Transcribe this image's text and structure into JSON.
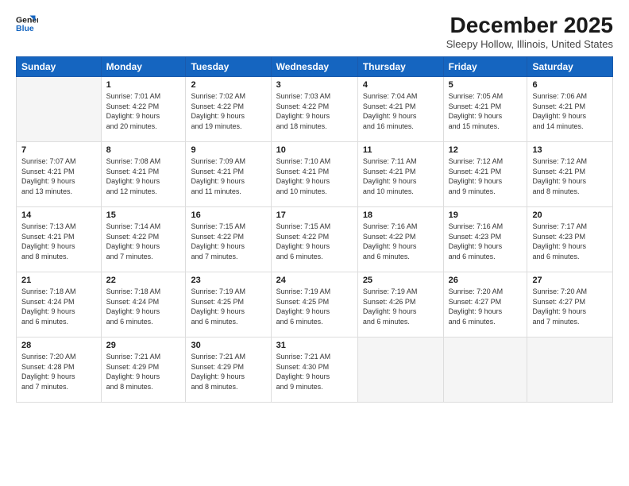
{
  "logo": {
    "line1": "General",
    "line2": "Blue"
  },
  "header": {
    "title": "December 2025",
    "location": "Sleepy Hollow, Illinois, United States"
  },
  "days_of_week": [
    "Sunday",
    "Monday",
    "Tuesday",
    "Wednesday",
    "Thursday",
    "Friday",
    "Saturday"
  ],
  "weeks": [
    [
      {
        "num": "",
        "info": ""
      },
      {
        "num": "1",
        "info": "Sunrise: 7:01 AM\nSunset: 4:22 PM\nDaylight: 9 hours\nand 20 minutes."
      },
      {
        "num": "2",
        "info": "Sunrise: 7:02 AM\nSunset: 4:22 PM\nDaylight: 9 hours\nand 19 minutes."
      },
      {
        "num": "3",
        "info": "Sunrise: 7:03 AM\nSunset: 4:22 PM\nDaylight: 9 hours\nand 18 minutes."
      },
      {
        "num": "4",
        "info": "Sunrise: 7:04 AM\nSunset: 4:21 PM\nDaylight: 9 hours\nand 16 minutes."
      },
      {
        "num": "5",
        "info": "Sunrise: 7:05 AM\nSunset: 4:21 PM\nDaylight: 9 hours\nand 15 minutes."
      },
      {
        "num": "6",
        "info": "Sunrise: 7:06 AM\nSunset: 4:21 PM\nDaylight: 9 hours\nand 14 minutes."
      }
    ],
    [
      {
        "num": "7",
        "info": "Sunrise: 7:07 AM\nSunset: 4:21 PM\nDaylight: 9 hours\nand 13 minutes."
      },
      {
        "num": "8",
        "info": "Sunrise: 7:08 AM\nSunset: 4:21 PM\nDaylight: 9 hours\nand 12 minutes."
      },
      {
        "num": "9",
        "info": "Sunrise: 7:09 AM\nSunset: 4:21 PM\nDaylight: 9 hours\nand 11 minutes."
      },
      {
        "num": "10",
        "info": "Sunrise: 7:10 AM\nSunset: 4:21 PM\nDaylight: 9 hours\nand 10 minutes."
      },
      {
        "num": "11",
        "info": "Sunrise: 7:11 AM\nSunset: 4:21 PM\nDaylight: 9 hours\nand 10 minutes."
      },
      {
        "num": "12",
        "info": "Sunrise: 7:12 AM\nSunset: 4:21 PM\nDaylight: 9 hours\nand 9 minutes."
      },
      {
        "num": "13",
        "info": "Sunrise: 7:12 AM\nSunset: 4:21 PM\nDaylight: 9 hours\nand 8 minutes."
      }
    ],
    [
      {
        "num": "14",
        "info": "Sunrise: 7:13 AM\nSunset: 4:21 PM\nDaylight: 9 hours\nand 8 minutes."
      },
      {
        "num": "15",
        "info": "Sunrise: 7:14 AM\nSunset: 4:22 PM\nDaylight: 9 hours\nand 7 minutes."
      },
      {
        "num": "16",
        "info": "Sunrise: 7:15 AM\nSunset: 4:22 PM\nDaylight: 9 hours\nand 7 minutes."
      },
      {
        "num": "17",
        "info": "Sunrise: 7:15 AM\nSunset: 4:22 PM\nDaylight: 9 hours\nand 6 minutes."
      },
      {
        "num": "18",
        "info": "Sunrise: 7:16 AM\nSunset: 4:22 PM\nDaylight: 9 hours\nand 6 minutes."
      },
      {
        "num": "19",
        "info": "Sunrise: 7:16 AM\nSunset: 4:23 PM\nDaylight: 9 hours\nand 6 minutes."
      },
      {
        "num": "20",
        "info": "Sunrise: 7:17 AM\nSunset: 4:23 PM\nDaylight: 9 hours\nand 6 minutes."
      }
    ],
    [
      {
        "num": "21",
        "info": "Sunrise: 7:18 AM\nSunset: 4:24 PM\nDaylight: 9 hours\nand 6 minutes."
      },
      {
        "num": "22",
        "info": "Sunrise: 7:18 AM\nSunset: 4:24 PM\nDaylight: 9 hours\nand 6 minutes."
      },
      {
        "num": "23",
        "info": "Sunrise: 7:19 AM\nSunset: 4:25 PM\nDaylight: 9 hours\nand 6 minutes."
      },
      {
        "num": "24",
        "info": "Sunrise: 7:19 AM\nSunset: 4:25 PM\nDaylight: 9 hours\nand 6 minutes."
      },
      {
        "num": "25",
        "info": "Sunrise: 7:19 AM\nSunset: 4:26 PM\nDaylight: 9 hours\nand 6 minutes."
      },
      {
        "num": "26",
        "info": "Sunrise: 7:20 AM\nSunset: 4:27 PM\nDaylight: 9 hours\nand 6 minutes."
      },
      {
        "num": "27",
        "info": "Sunrise: 7:20 AM\nSunset: 4:27 PM\nDaylight: 9 hours\nand 7 minutes."
      }
    ],
    [
      {
        "num": "28",
        "info": "Sunrise: 7:20 AM\nSunset: 4:28 PM\nDaylight: 9 hours\nand 7 minutes."
      },
      {
        "num": "29",
        "info": "Sunrise: 7:21 AM\nSunset: 4:29 PM\nDaylight: 9 hours\nand 8 minutes."
      },
      {
        "num": "30",
        "info": "Sunrise: 7:21 AM\nSunset: 4:29 PM\nDaylight: 9 hours\nand 8 minutes."
      },
      {
        "num": "31",
        "info": "Sunrise: 7:21 AM\nSunset: 4:30 PM\nDaylight: 9 hours\nand 9 minutes."
      },
      {
        "num": "",
        "info": ""
      },
      {
        "num": "",
        "info": ""
      },
      {
        "num": "",
        "info": ""
      }
    ]
  ]
}
